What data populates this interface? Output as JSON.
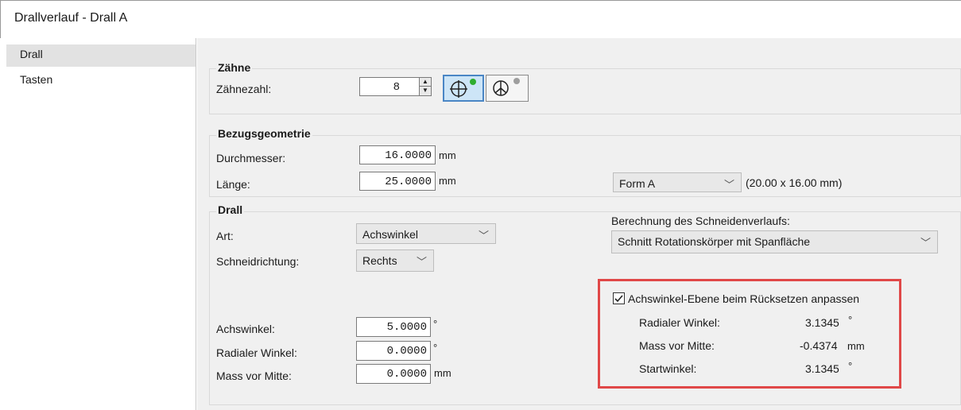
{
  "window": {
    "title": "Drallverlauf - Drall A"
  },
  "sidebar": {
    "items": [
      {
        "label": "Drall"
      },
      {
        "label": "Tasten"
      }
    ]
  },
  "zaehne": {
    "title": "Zähne",
    "count_label": "Zähnezahl:",
    "count_value": "8"
  },
  "bezug": {
    "title": "Bezugsgeometrie",
    "durchmesser_label": "Durchmesser:",
    "durchmesser_value": "16.0000",
    "durchmesser_unit": "mm",
    "laenge_label": "Länge:",
    "laenge_value": "25.0000",
    "laenge_unit": "mm",
    "form_value": "Form A",
    "form_dims": "(20.00 x 16.00 mm)"
  },
  "drall": {
    "title": "Drall",
    "art_label": "Art:",
    "art_value": "Achswinkel",
    "schneid_label": "Schneidrichtung:",
    "schneid_value": "Rechts",
    "berechnung_label": "Berechnung des Schneidenverlaufs:",
    "berechnung_value": "Schnitt Rotationskörper mit Spanfläche",
    "achswinkel_label": "Achswinkel:",
    "achswinkel_value": "5.0000",
    "achswinkel_unit": "°",
    "radial_label": "Radialer Winkel:",
    "radial_value": "0.0000",
    "radial_unit": "°",
    "mass_label": "Mass vor Mitte:",
    "mass_value": "0.0000",
    "mass_unit": "mm"
  },
  "reset": {
    "checkbox_label": "Achswinkel-Ebene beim Rücksetzen anpassen",
    "checked": true,
    "radial_label": "Radialer Winkel:",
    "radial_value": "3.1345",
    "radial_unit": "°",
    "mass_label": "Mass vor Mitte:",
    "mass_value": "-0.4374",
    "mass_unit": "mm",
    "start_label": "Startwinkel:",
    "start_value": "3.1345",
    "start_unit": "°",
    "highlight_color": "#e04848"
  }
}
